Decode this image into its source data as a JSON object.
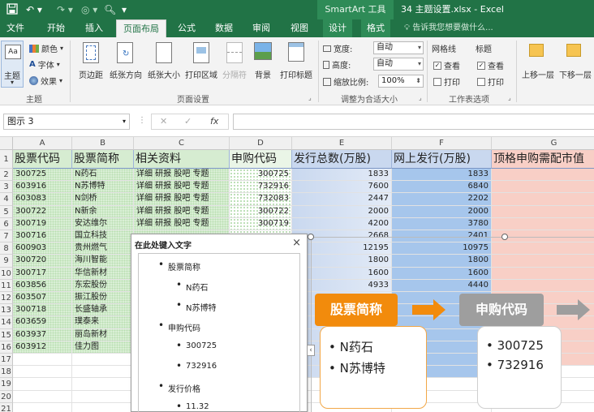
{
  "window": {
    "context_tools": "SmartArt 工具",
    "title": "34 主题设置.xlsx - Excel"
  },
  "tabs": [
    "文件",
    "开始",
    "插入",
    "页面布局",
    "公式",
    "数据",
    "审阅",
    "视图",
    "设计",
    "格式"
  ],
  "active_tab": "页面布局",
  "tell_me": "告诉我您想要做什么...",
  "ribbon": {
    "theme": {
      "main": "主题",
      "colors": "颜色",
      "fonts": "字体",
      "effects": "效果",
      "group": "主题"
    },
    "page_setup": {
      "margins": "页边距",
      "orientation": "纸张方向",
      "size": "纸张大小",
      "print_area": "打印区域",
      "breaks": "分隔符",
      "background": "背景",
      "print_titles": "打印标题",
      "group": "页面设置"
    },
    "scale": {
      "width_label": "宽度:",
      "width_value": "自动",
      "height_label": "高度:",
      "height_value": "自动",
      "scale_label": "缩放比例:",
      "scale_value": "100%",
      "group": "调整为合适大小"
    },
    "sheet_options": {
      "gridlines": "网格线",
      "headings": "标题",
      "view": "查看",
      "print": "打印",
      "group": "工作表选项"
    },
    "arrange": {
      "bring_forward": "上移一层",
      "send_backward": "下移一层"
    }
  },
  "formula_bar": {
    "name_box": "图示 3",
    "fx": "fx"
  },
  "columns": [
    "A",
    "B",
    "C",
    "D",
    "E",
    "F",
    "G"
  ],
  "rows": [
    "1",
    "2",
    "3",
    "4",
    "5",
    "6",
    "7",
    "8",
    "9",
    "10",
    "11",
    "12",
    "13",
    "14",
    "15",
    "16",
    "17",
    "18",
    "19",
    "20",
    "21"
  ],
  "headers": [
    "股票代码",
    "股票简称",
    "相关资料",
    "申购代码",
    "发行总数(万股)",
    "网上发行(万股)",
    "顶格申购需配市值"
  ],
  "table": [
    [
      "300725",
      "N药石",
      "详细 研报 股吧 专题",
      "300725",
      "1833",
      "1833"
    ],
    [
      "603916",
      "N苏博特",
      "详细 研报 股吧 专题",
      "732916",
      "7600",
      "6840"
    ],
    [
      "603083",
      "N剑桥",
      "详细 研报 股吧 专题",
      "732083",
      "2447",
      "2202"
    ],
    [
      "300722",
      "N新余",
      "详细 研报 股吧 专题",
      "300722",
      "2000",
      "2000"
    ],
    [
      "300719",
      "安达维尔",
      "详细 研报 股吧 专题",
      "300719",
      "4200",
      "3780"
    ],
    [
      "300716",
      "国立科技",
      "",
      "",
      "2668",
      "2401"
    ],
    [
      "600903",
      "贵州燃气",
      "",
      "",
      "12195",
      "10975"
    ],
    [
      "300720",
      "海川智能",
      "",
      "",
      "1800",
      "1800"
    ],
    [
      "300717",
      "华信新材",
      "",
      "",
      "1600",
      "1600"
    ],
    [
      "603856",
      "东宏股份",
      "",
      "",
      "4933",
      "4440"
    ],
    [
      "603507",
      "振江股份",
      "",
      "",
      "",
      ""
    ],
    [
      "300718",
      "长盛轴承",
      "",
      "",
      "",
      ""
    ],
    [
      "603659",
      "璞泰来",
      "",
      "",
      "",
      ""
    ],
    [
      "603937",
      "丽岛新材",
      "",
      "",
      "",
      ""
    ],
    [
      "603912",
      "佳力图",
      "",
      "",
      "",
      ""
    ]
  ],
  "text_pane": {
    "title": "在此处键入文字",
    "close": "×",
    "items": [
      {
        "text": "股票简称",
        "level": 1
      },
      {
        "text": "N药石",
        "level": 2
      },
      {
        "text": "N苏博特",
        "level": 2
      },
      {
        "text": "申购代码",
        "level": 1
      },
      {
        "text": "300725",
        "level": 2
      },
      {
        "text": "732916",
        "level": 2
      },
      {
        "text": "发行价格",
        "level": 1
      },
      {
        "text": "11.32",
        "level": 2
      }
    ]
  },
  "smartart": {
    "box1": {
      "title": "股票简称",
      "items": [
        "N药石",
        "N苏博特"
      ],
      "color": "#f28b0c"
    },
    "box2": {
      "title": "申购代码",
      "items": [
        "300725",
        "732916"
      ],
      "color": "#9e9e9e"
    },
    "expand": "‹"
  }
}
